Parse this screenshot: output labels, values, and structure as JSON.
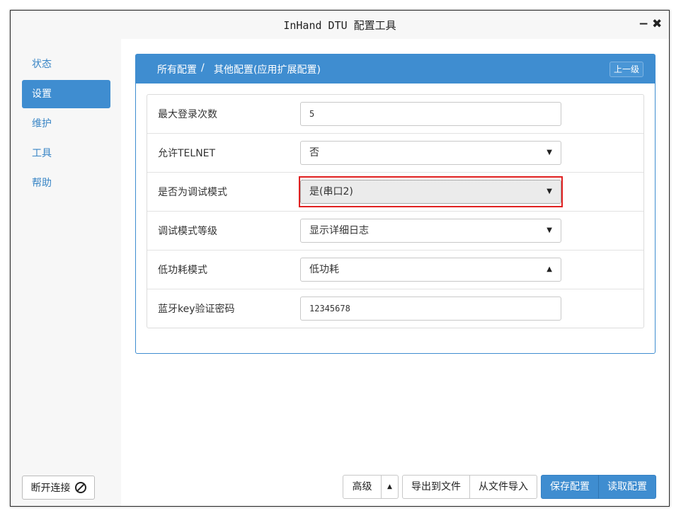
{
  "window": {
    "title": "InHand DTU 配置工具",
    "minimize": "−",
    "close": "✖"
  },
  "sidebar": {
    "items": [
      {
        "label": "状态",
        "active": false
      },
      {
        "label": "设置",
        "active": true
      },
      {
        "label": "维护",
        "active": false
      },
      {
        "label": "工具",
        "active": false
      },
      {
        "label": "帮助",
        "active": false
      }
    ],
    "disconnect_label": "断开连接"
  },
  "panel": {
    "breadcrumb": {
      "root": "所有配置",
      "separator": "/",
      "current": "其他配置(应用扩展配置)"
    },
    "up_button": "上一级",
    "rows": [
      {
        "label": "最大登录次数",
        "type": "input",
        "value": "5"
      },
      {
        "label": "允许TELNET",
        "type": "select",
        "value": "否"
      },
      {
        "label": "是否为调试模式",
        "type": "select",
        "value": "是(串口2)"
      },
      {
        "label": "调试模式等级",
        "type": "select",
        "value": "显示详细日志"
      },
      {
        "label": "低功耗模式",
        "type": "select",
        "value": "低功耗"
      },
      {
        "label": "蓝牙key验证密码",
        "type": "input",
        "value": "12345678"
      }
    ]
  },
  "footer": {
    "advanced": "高级",
    "advanced_toggle": "▲",
    "export": "导出到文件",
    "import": "从文件导入",
    "save": "保存配置",
    "read": "读取配置"
  },
  "colors": {
    "accent": "#3f8dd0",
    "highlight": "#e02020"
  }
}
